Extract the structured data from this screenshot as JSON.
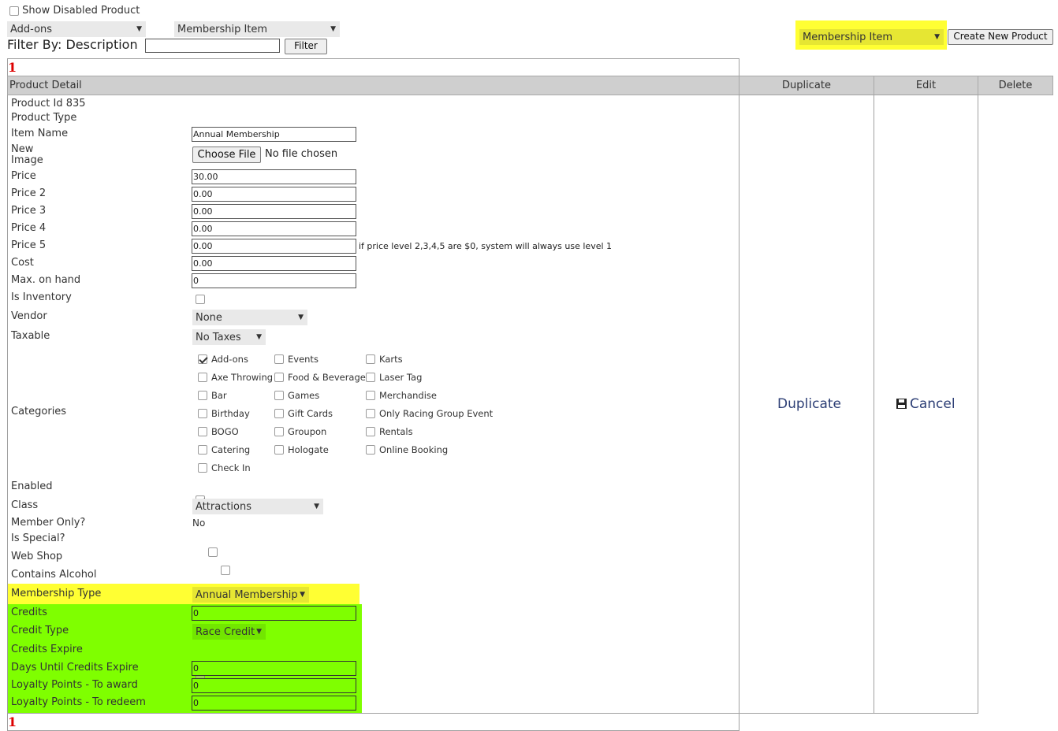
{
  "top": {
    "show_disabled_label": "Show Disabled Product",
    "category_select": "Add-ons",
    "type_select": "Membership Item",
    "filter_by_label": "Filter By: Description",
    "filter_input_value": "",
    "filter_button": "Filter",
    "new_type_select": "Membership Item",
    "create_button": "Create New Product"
  },
  "pager": {
    "top": "1",
    "bottom": "1"
  },
  "table": {
    "headers": {
      "detail": "Product Detail",
      "duplicate": "Duplicate",
      "edit": "Edit",
      "delete": "Delete"
    },
    "duplicate_link": "Duplicate",
    "cancel_link": "Cancel"
  },
  "form": {
    "product_id": "Product Id 835",
    "product_type_label": "Product Type",
    "item_name_label": "Item Name",
    "item_name_value": "Annual Membership",
    "new_label": "New",
    "image_label": "Image",
    "choose_file": "Choose File",
    "no_file": "No file chosen",
    "price_label": "Price",
    "price_value": "30.00",
    "price2_label": "Price 2",
    "price2_value": "0.00",
    "price3_label": "Price 3",
    "price3_value": "0.00",
    "price4_label": "Price 4",
    "price4_value": "0.00",
    "price5_label": "Price 5",
    "price5_value": "0.00",
    "price_note": "if price level 2,3,4,5 are $0, system will always use level 1",
    "cost_label": "Cost",
    "cost_value": "0.00",
    "max_label": "Max. on hand",
    "max_value": "0",
    "inventory_label": "Is Inventory",
    "vendor_label": "Vendor",
    "vendor_value": "None",
    "taxable_label": "Taxable",
    "taxable_value": "No Taxes",
    "categories_label": "Categories",
    "enabled_label": "Enabled",
    "class_label": "Class",
    "class_value": "Attractions",
    "member_only_label": "Member Only?",
    "member_only_value": "No",
    "special_label": "Is Special?",
    "webshop_label": "Web Shop",
    "alcohol_label": "Contains Alcohol",
    "membership_type_label": "Membership Type",
    "membership_type_value": "Annual Membership",
    "credits_label": "Credits",
    "credits_value": "0",
    "credit_type_label": "Credit Type",
    "credit_type_value": "Race Credit",
    "credits_expire_label": "Credits Expire",
    "days_label": "Days Until Credits Expire",
    "days_value": "0",
    "award_label": "Loyalty Points - To award",
    "award_value": "0",
    "redeem_label": "Loyalty Points - To redeem",
    "redeem_value": "0"
  },
  "categories": {
    "col1": [
      "Add-ons",
      "Axe Throwing",
      "Bar",
      "Birthday",
      "BOGO",
      "Catering",
      "Check In"
    ],
    "col2": [
      "Events",
      "Food & Beverage",
      "Games",
      "Gift Cards",
      "Groupon",
      "Hologate"
    ],
    "col3": [
      "Karts",
      "Laser Tag",
      "Merchandise",
      "Only Racing Group Event",
      "Rentals",
      "Online Booking"
    ],
    "checked": [
      "Add-ons"
    ]
  },
  "colors": {
    "highlight_yellow": "#ffff33",
    "highlight_green": "#7fff00",
    "link": "#2c3e75"
  }
}
